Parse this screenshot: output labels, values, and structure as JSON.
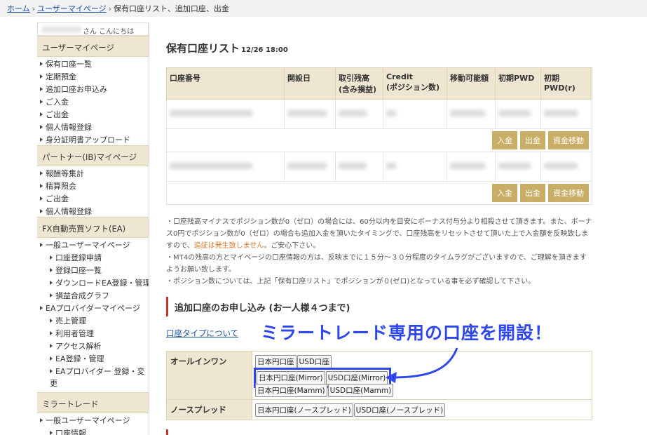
{
  "breadcrumb": {
    "home": "ホーム",
    "mypage": "ユーザーマイページ",
    "current": "保有口座リスト、追加口座、出金"
  },
  "sidebar": {
    "greeting": "さん こんにちは",
    "sections": [
      {
        "title": "ユーザーマイページ",
        "items": [
          "保有口座一覧",
          "定期預金",
          "追加口座お申込み",
          "ご入金",
          "ご出金",
          "個人情報登録",
          "身分証明書アップロード"
        ]
      },
      {
        "title": "パートナー(IB)マイページ",
        "items": [
          "報酬等集計",
          "精算照会",
          "ご出金",
          "個人情報登録"
        ]
      },
      {
        "title": "FX自動売買ソフト(EA)",
        "items": [
          "一般ユーザーマイページ"
        ],
        "subitems": [
          "口座登録申請",
          "登録口座一覧",
          "ダウンロードEA登録・管理",
          "損益合成グラフ"
        ],
        "items2": [
          "EAプロバイダーマイページ"
        ],
        "subitems2": [
          "売上管理",
          "利用者管理",
          "アクセス解析",
          "EA登録・管理",
          "EAプロバイダー 登録・変更"
        ]
      },
      {
        "title": "ミラートレード",
        "items": [
          "一般ユーザーマイページ"
        ],
        "subitems": [
          "口座情報"
        ]
      }
    ]
  },
  "main": {
    "title": "保有口座リスト",
    "timestamp": "12/26 18:00",
    "columns": [
      "口座番号",
      "開設日",
      "取引残高\n(含み損益)",
      "Credit\n(ポジション数)",
      "移動可能額",
      "初期PWD",
      "初期PWD(r)"
    ],
    "buttons": {
      "deposit": "入金",
      "withdraw": "出金",
      "transfer": "資金移動"
    },
    "notes": {
      "p1a": "・口座残高マイナスでポジション数が0（ゼロ）の場合には、60分以内を目安にボーナス付与分より相殺させて頂きます。また、ボーナス0円でポジション数が0（ゼロ）の場合も追加入金を頂いたタイミングで、口座残高をリセットさせて頂いた上で入金額を反映致しますので、",
      "p1red": "追証は発生致しません",
      "p1b": "。ご安心下さい。",
      "p2": "・MT4の残高の方とマイページの口座情報の方は、反映までに１５分～３０分程度のタイムラグがございますので、ご理解を頂きますようお願い致します。",
      "p3": "・ポジション数については、上記「保有口座リスト」でポジションが０(ゼロ)となっている事を必ず確認して下さい。"
    },
    "add_account": {
      "heading": "追加口座のお申し込み (お一人様４つまで)",
      "type_link": "口座タイプについて",
      "callout": "ミラートレード専用の口座を開設！",
      "rows": [
        {
          "label": "オールインワン",
          "buttons": [
            "日本円口座",
            "USD口座"
          ],
          "mirror": [
            "日本円口座(Mirror)",
            "USD口座(Mirror)"
          ],
          "mamm": [
            "日本円口座(Mamm)",
            "USD口座(Mamm)"
          ]
        },
        {
          "label": "ノースプレッド",
          "buttons": [
            "日本円口座(ノースプレッド)",
            "USD口座(ノースプレッド)"
          ]
        }
      ]
    }
  },
  "colors": {
    "accent_gold": "#c9ae68",
    "header_beige": "#efe6d2",
    "callout_blue": "#2e47ec",
    "heading_red": "#c0392b"
  },
  "icons": [
    "chevron-right-icon",
    "arrow-curve-icon"
  ]
}
